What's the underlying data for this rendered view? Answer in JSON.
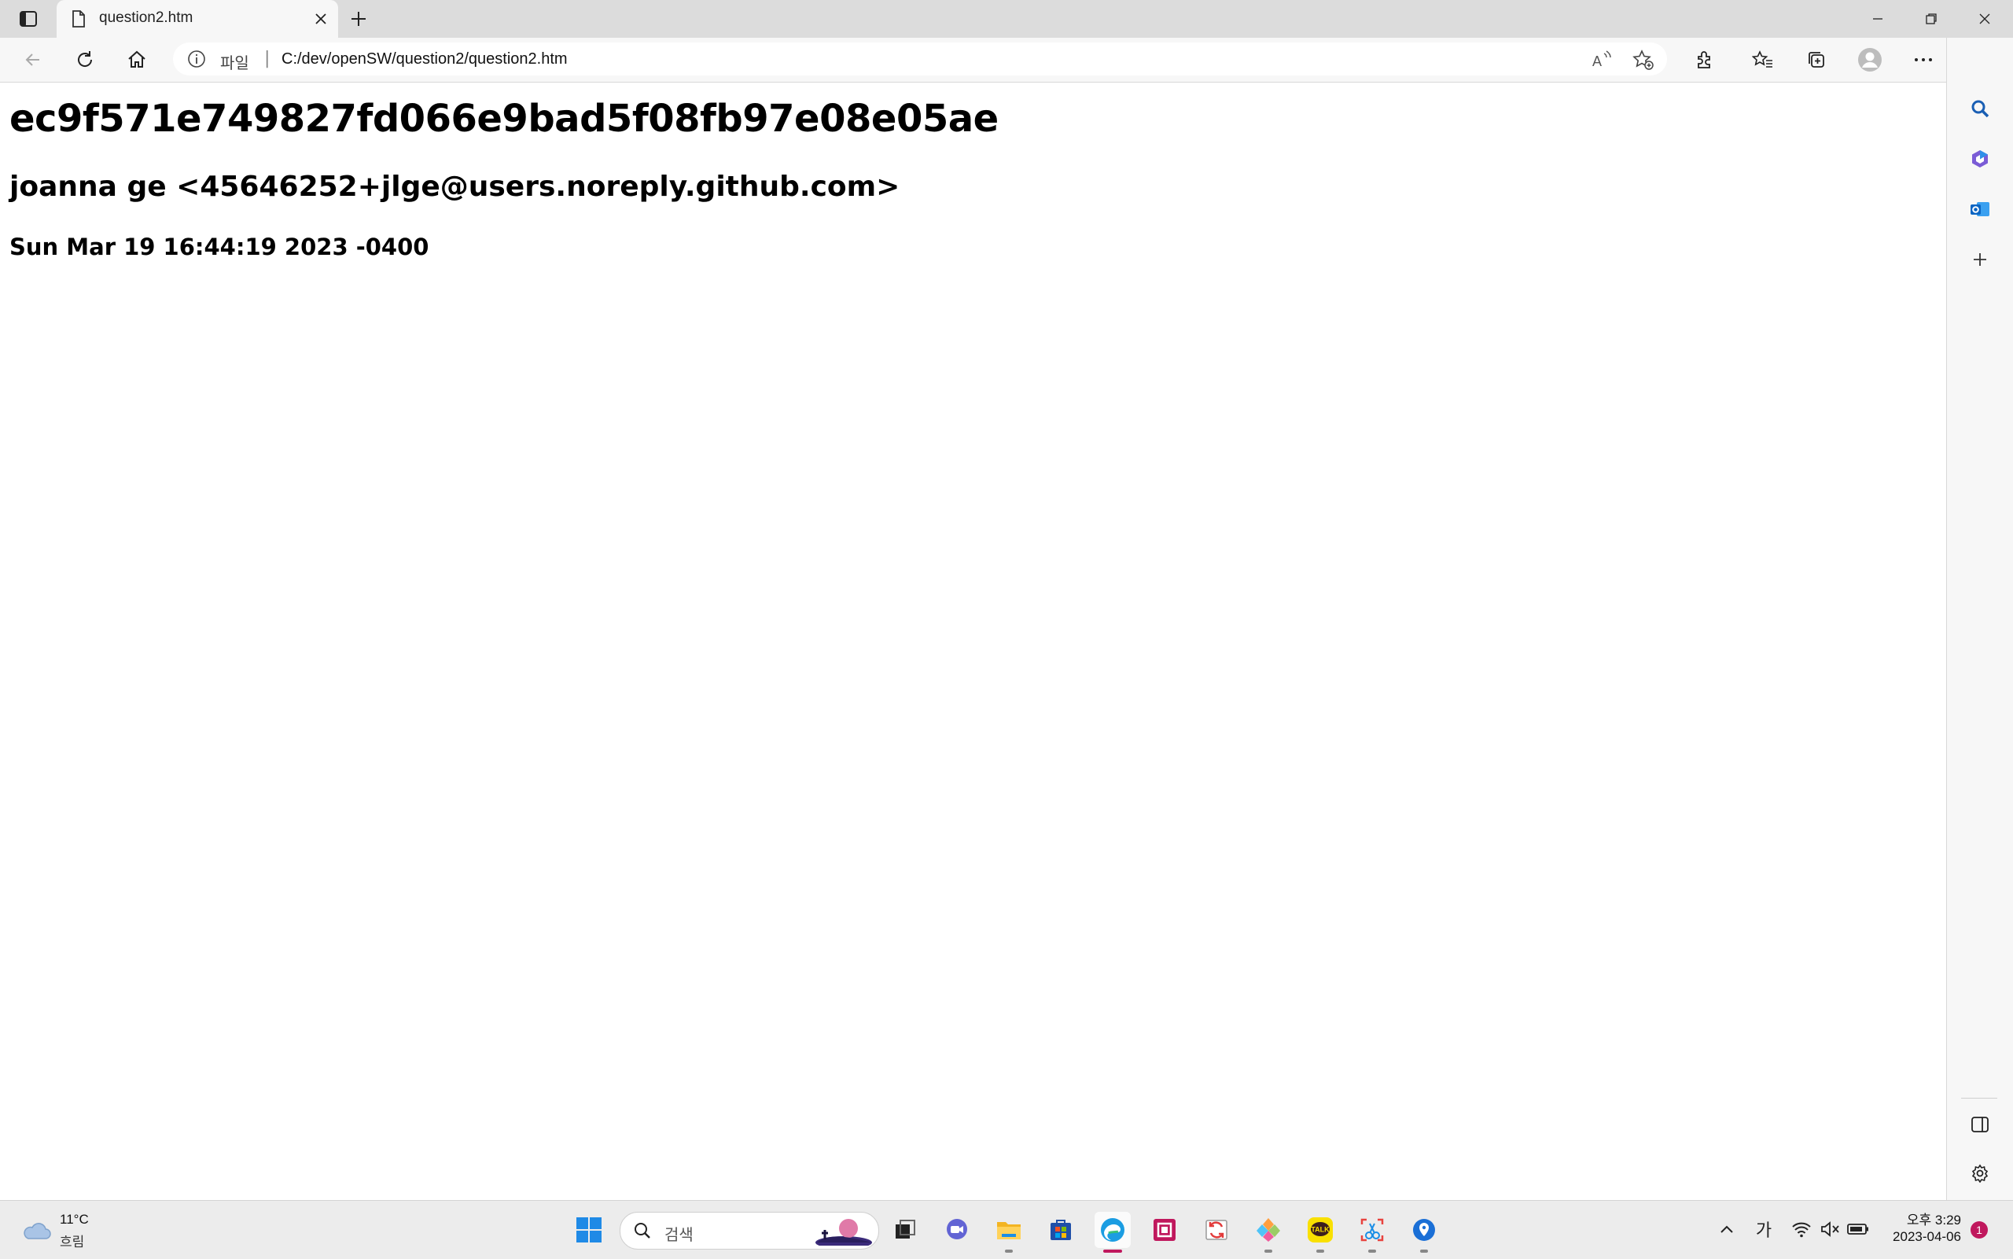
{
  "browser": {
    "tab": {
      "title": "question2.htm"
    },
    "address": {
      "scheme_label": "파일",
      "url": "C:/dev/openSW/question2/question2.htm"
    }
  },
  "page": {
    "commit_hash": "ec9f571e749827fd066e9bad5f08fb97e08e05ae",
    "author": "joanna ge <45646252+jlge@users.noreply.github.com>",
    "date": "Sun Mar 19 16:44:19 2023 -0400"
  },
  "taskbar": {
    "weather": {
      "temp": "11°C",
      "desc": "흐림"
    },
    "search_placeholder": "검색",
    "tray": {
      "ime": "가",
      "time": "오후 3:29",
      "date": "2023-04-06",
      "notifications": "1"
    }
  },
  "colors": {
    "accent": "#c0185d",
    "edge_blue": "#0b7bd6"
  }
}
